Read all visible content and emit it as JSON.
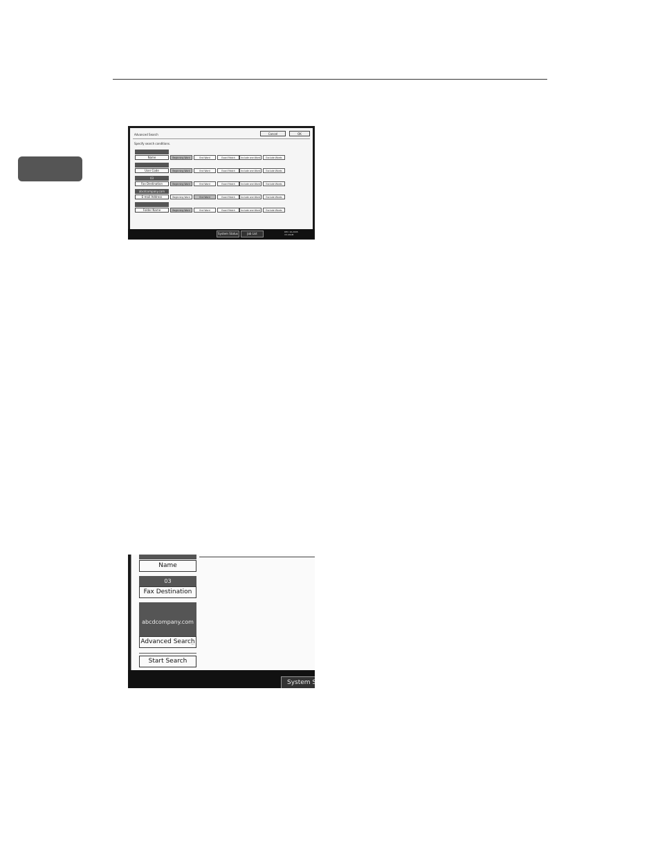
{
  "screen1": {
    "title": "Advanced Search",
    "cancel_label": "Cancel",
    "ok_label": "OK",
    "instruction": "Specify search conditions.",
    "options": [
      "Beginning Word",
      "End Word",
      "Exact Match",
      "Include one Word",
      "Exclude Words"
    ],
    "fields": [
      {
        "top": "",
        "label": "Name",
        "selected": "Beginning Word"
      },
      {
        "top": "",
        "label": "User Code",
        "selected": "Beginning Word"
      },
      {
        "top": "03",
        "label": "Fax Destination",
        "selected": "Beginning Word"
      },
      {
        "top": "abcdcompany.com",
        "label": "E-mail Address",
        "selected": "End Word"
      },
      {
        "top": "",
        "label": "Folder Name",
        "selected": "Beginning Word"
      }
    ],
    "system_status_label": "System Status",
    "job_list_label": "Job List",
    "date": "DEC 16,2005",
    "time": "15:43AM"
  },
  "screen2": {
    "name_label": "Name",
    "fax_value": "03",
    "fax_label": "Fax Destination",
    "email_value": "abcdcompany.com",
    "advanced_search_label": "Advanced Search",
    "ellipsis": "...",
    "start_search_label": "Start Search",
    "system_status_label": "System Statu"
  }
}
